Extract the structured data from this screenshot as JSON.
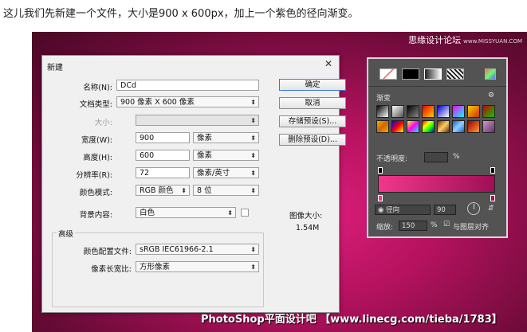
{
  "caption": "这儿我们先新建一个文件，大小是900 x 600px，加上一个紫色的径向渐变。",
  "watermark_top": {
    "main": "思缘设计论坛",
    "sub": "www.MISSYUAN.COM"
  },
  "watermark_bottom": "PhotoShop平面设计吧 【www.linecg.com/tieba/1783】",
  "dialog": {
    "title": "新建",
    "close": "✕",
    "name_label": "名称(N):",
    "name_value": "DCd",
    "doc_type_label": "文档类型:",
    "doc_type_value": "900 像素 X 600 像素",
    "size_label": "大小:",
    "width_label": "宽度(W):",
    "width_value": "900",
    "width_unit": "像素",
    "height_label": "高度(H):",
    "height_value": "600",
    "height_unit": "像素",
    "resolution_label": "分辨率(R):",
    "resolution_value": "72",
    "resolution_unit": "像素/英寸",
    "color_mode_label": "颜色模式:",
    "color_mode_value": "RGB 颜色",
    "bit_depth_value": "8 位",
    "background_label": "背景内容:",
    "background_value": "白色",
    "advanced_title": "高级",
    "color_profile_label": "颜色配置文件:",
    "color_profile_value": "sRGB IEC61966-2.1",
    "pixel_aspect_label": "像素长宽比:",
    "pixel_aspect_value": "方形像素",
    "image_size_label": "图像大小:",
    "image_size_value": "1.54M",
    "ok_button": "确定",
    "cancel_button": "取消",
    "save_preset_button": "存储预设(S)...",
    "delete_preset_button": "删除预设(D)..."
  },
  "gradient_panel": {
    "title": "渐变",
    "opacity_label": "不透明度:",
    "opacity_unit": "%",
    "style_value": "径向",
    "angle_value": "90",
    "scale_label": "缩放:",
    "scale_value": "150",
    "scale_unit": "%",
    "align_label": "与图层对齐",
    "gradient_colors": [
      "#f2378c",
      "#9e1055"
    ]
  }
}
